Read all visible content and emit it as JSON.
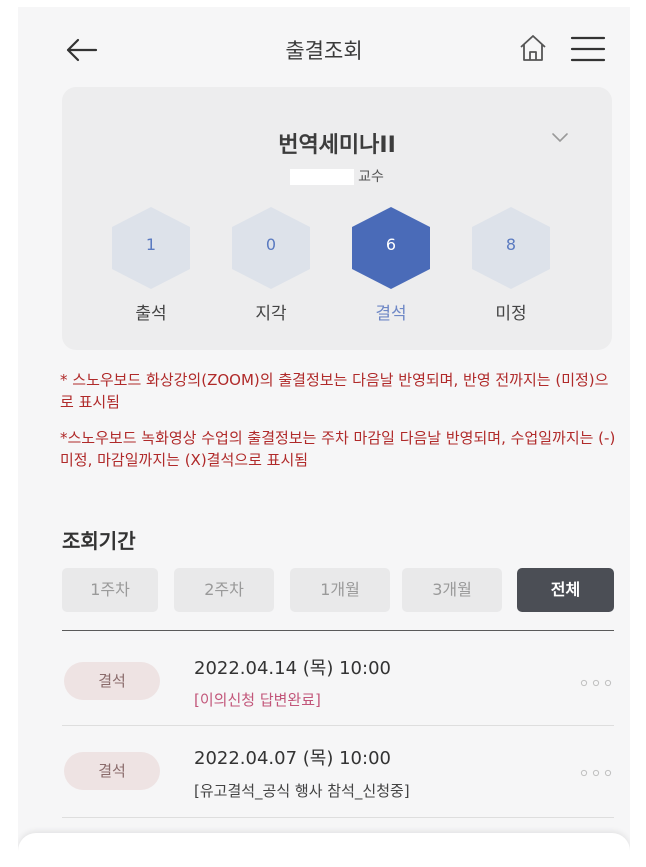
{
  "header": {
    "title": "출결조회"
  },
  "course": {
    "name": "번역세미나II",
    "professor_suffix": "교수"
  },
  "stats": [
    {
      "value": "1",
      "label": "출석",
      "active": false
    },
    {
      "value": "0",
      "label": "지각",
      "active": false
    },
    {
      "value": "6",
      "label": "결석",
      "active": true
    },
    {
      "value": "8",
      "label": "미정",
      "active": false
    }
  ],
  "notices": [
    "* 스노우보드 화상강의(ZOOM)의 출결정보는 다음날 반영되며, 반영 전까지는 (미정)으로 표시됨",
    "*스노우보드 녹화영상 수업의 출결정보는 주차 마감일 다음날 반영되며, 수업일까지는 (-)미정, 마감일까지는 (X)결석으로 표시됨"
  ],
  "period": {
    "title": "조회기간",
    "options": [
      "1주차",
      "2주차",
      "1개월",
      "3개월",
      "전체"
    ],
    "selected": "전체"
  },
  "records": [
    {
      "badge": "결석",
      "date": "2022.04.14 (목) 10:00",
      "status": "[이의신청 답변완료]",
      "status_color": "#c2567a"
    },
    {
      "badge": "결석",
      "date": "2022.04.07 (목) 10:00",
      "status": "[유고결석_공식 행사 참석_신청중]",
      "status_color": "#444444"
    }
  ],
  "colors": {
    "accent": "#4a6bb8",
    "hex_inactive": "#dde2ea",
    "notice": "#b02a2a"
  }
}
